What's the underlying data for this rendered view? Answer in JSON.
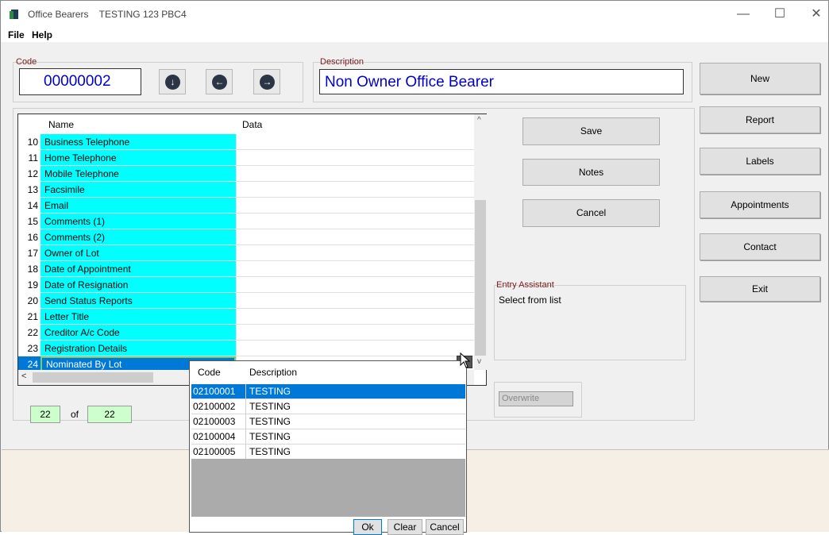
{
  "window": {
    "title": "Office Bearers",
    "subtitle": "TESTING 123 PBC4",
    "controls": {
      "minimize": "—",
      "maximize": "☐",
      "close": "✕"
    }
  },
  "menu": [
    "File",
    "Help"
  ],
  "code": {
    "label": "Code",
    "value": "00000002"
  },
  "description": {
    "label": "Description",
    "value": "Non Owner Office Bearer"
  },
  "nav_buttons": {
    "down": "↓",
    "back": "←",
    "forward": "→"
  },
  "grid": {
    "col_name": "Name",
    "col_data": "Data",
    "rows": [
      {
        "n": "10",
        "name": "Business Telephone"
      },
      {
        "n": "11",
        "name": "Home Telephone"
      },
      {
        "n": "12",
        "name": "Mobile Telephone"
      },
      {
        "n": "13",
        "name": "Facsimile"
      },
      {
        "n": "14",
        "name": "Email"
      },
      {
        "n": "15",
        "name": "Comments (1)"
      },
      {
        "n": "16",
        "name": "Comments (2)"
      },
      {
        "n": "17",
        "name": "Owner of Lot"
      },
      {
        "n": "18",
        "name": "Date of Appointment"
      },
      {
        "n": "19",
        "name": "Date of Resignation"
      },
      {
        "n": "20",
        "name": "Send Status Reports"
      },
      {
        "n": "21",
        "name": "Letter Title"
      },
      {
        "n": "22",
        "name": "Creditor A/c Code"
      },
      {
        "n": "23",
        "name": "Registration Details"
      },
      {
        "n": "24",
        "name": "Nominated By Lot"
      }
    ]
  },
  "counter": {
    "current": "22",
    "of": "of",
    "total": "22"
  },
  "actions": {
    "save": "Save",
    "notes": "Notes",
    "cancel": "Cancel"
  },
  "entry_assistant": {
    "label": "Entry Assistant",
    "text": "Select from list"
  },
  "overwrite": "Overwrite",
  "side_buttons": {
    "new": "New",
    "report": "Report",
    "labels": "Labels",
    "appointments": "Appointments",
    "contact": "Contact",
    "exit": "Exit"
  },
  "popup": {
    "col_code": "Code",
    "col_desc": "Description",
    "rows": [
      {
        "code": "02100001",
        "desc": "TESTING"
      },
      {
        "code": "02100002",
        "desc": "TESTING"
      },
      {
        "code": "02100003",
        "desc": "TESTING"
      },
      {
        "code": "02100004",
        "desc": "TESTING"
      },
      {
        "code": "02100005",
        "desc": "TESTING"
      }
    ],
    "ok": "Ok",
    "clear": "Clear",
    "cancel": "Cancel"
  },
  "colors": {
    "cyan": "#00ffff",
    "selection": "#0078d7",
    "code_text": "#0000cc",
    "counter_bg": "#ccffcc"
  }
}
